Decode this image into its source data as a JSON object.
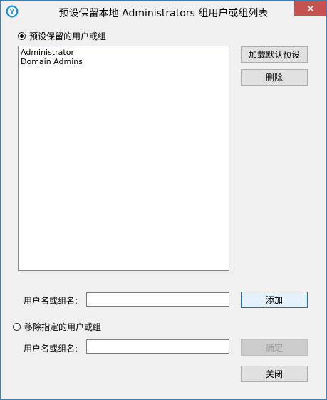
{
  "window": {
    "title": "预设保留本地 Administrators 组用户或组列表"
  },
  "option_reserve": {
    "label": "预设保留的用户或组",
    "checked": true
  },
  "reserve_list": {
    "items": [
      "Administrator",
      "Domain Admins"
    ]
  },
  "buttons": {
    "load_default": "加载默认预设",
    "delete": "删除",
    "add": "添加",
    "confirm": "确定",
    "close": "关闭"
  },
  "add_field": {
    "label": "用户名或组名:",
    "value": ""
  },
  "option_remove": {
    "label": "移除指定的用户或组",
    "checked": false
  },
  "remove_field": {
    "label": "用户名或组名:",
    "value": ""
  },
  "colors": {
    "close_button": "#c75050",
    "window_bg": "#f0f0f0",
    "focus_border": "#0078d7"
  }
}
